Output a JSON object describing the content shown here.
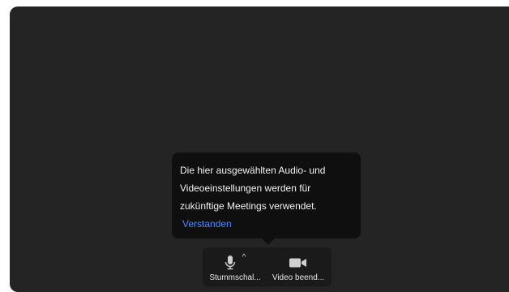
{
  "tooltip": {
    "message": "Die hier ausgewählten Audio- und\nVideoeinstellungen werden für\nzukünftige Meetings verwendet.",
    "confirm_label": "Verstanden"
  },
  "toolbar": {
    "mute_label": "Stummschal...",
    "mute_options_symbol": "^",
    "video_label": "Video beend..."
  },
  "icons": {
    "mute": "microphone-icon",
    "mute_options": "caret-up-icon",
    "video": "video-camera-icon"
  },
  "colors": {
    "background": "#242424",
    "tooltip": "#0f0f0f",
    "link": "#4a8cff"
  }
}
